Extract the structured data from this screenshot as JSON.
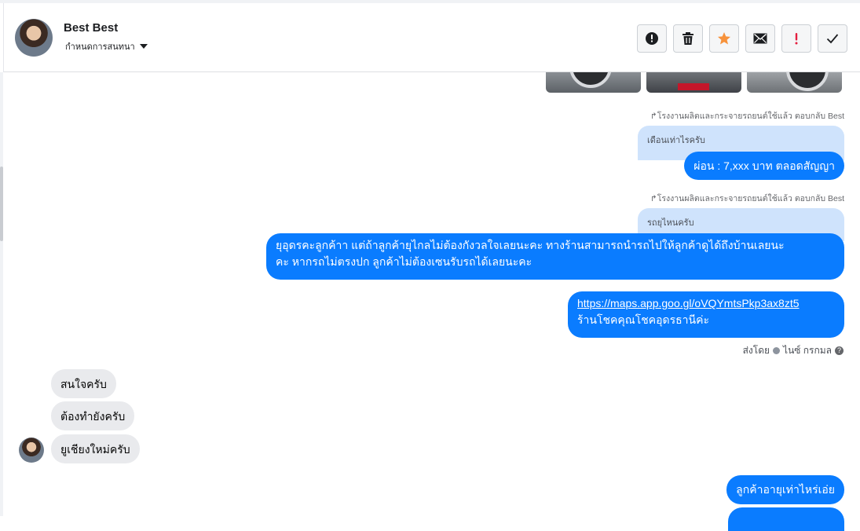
{
  "header": {
    "contact_name": "Best Best",
    "assign_label": "กำหนดการสนทนา",
    "actions": [
      {
        "name": "report-button",
        "icon": "alert-circle-icon"
      },
      {
        "name": "delete-button",
        "icon": "trash-icon"
      },
      {
        "name": "star-button",
        "icon": "star-icon"
      },
      {
        "name": "mark-unread-button",
        "icon": "envelope-icon"
      },
      {
        "name": "important-button",
        "icon": "exclamation-icon"
      },
      {
        "name": "done-button",
        "icon": "check-icon"
      }
    ]
  },
  "messages": {
    "reply_note_1": "โรงงานผลิตและกระจายรถยนต์ใช้แล้ว ตอบกลับ Best",
    "quoted_1": "เดือนเท่าไรครับ",
    "out_1": "ผ่อน : 7,xxx บาท ตลอดสัญญา",
    "reply_note_2": "โรงงานผลิตและกระจายรถยนต์ใช้แล้ว ตอบกลับ Best",
    "quoted_2": "รถยุไหนครับ",
    "out_2_line1": "ยุอุดรคะลูกค้าา แต่ถ้าลูกค้ายุไกลไม่ต้องกังวลใจเลยนะคะ ทางร้านสามารถนำรถไปให้ลูกค้าดูได้ถึงบ้านเลยนะ",
    "out_2_line2": "คะ หากรถไม่ตรงปก ลูกค้าไม่ต้องเซนรับรถได้เลยนะคะ",
    "out_3_link": "https://maps.app.goo.gl/oVQYmtsPkp3ax8zt5",
    "out_3_text": "ร้านโชคคุณโชคอุดรธานีค่ะ",
    "sent_by_label": "ส่งโดย",
    "sent_by_name": "ไนซ์ กรกมล",
    "in_1": "สนใจครับ",
    "in_2": "ต้องทำยังครับ",
    "in_3": "ยูเชียงใหม่ครับ",
    "out_4": "ลูกค้าอายุเท่าไหร่เอ่ย"
  },
  "colors": {
    "outgoing_bubble": "#0a7cff",
    "incoming_bubble": "#e9eaed",
    "quoted_bubble": "#cfe3fc",
    "star": "#f7923b",
    "important": "#e41e3f"
  }
}
